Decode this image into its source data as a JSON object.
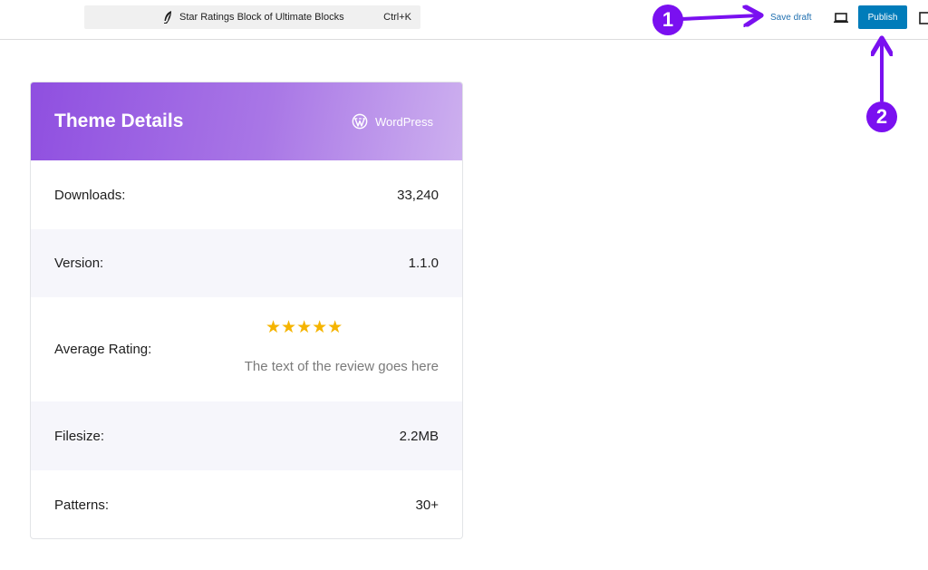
{
  "toolbar": {
    "document_title": "Star Ratings Block of Ultimate Blocks",
    "shortcut": "Ctrl+K",
    "save_draft_label": "Save draft",
    "publish_label": "Publish"
  },
  "annotations": {
    "badge_1": "1",
    "badge_2": "2",
    "color": "#7a10f0"
  },
  "card": {
    "title": "Theme Details",
    "brand": "WordPress",
    "rows": [
      {
        "label": "Downloads:",
        "value": "33,240"
      },
      {
        "label": "Version:",
        "value": "1.1.0"
      },
      {
        "label": "Average Rating:",
        "stars": "★★★★★",
        "rating": 5,
        "review": "The text of the review goes here"
      },
      {
        "label": "Filesize:",
        "value": "2.2MB"
      },
      {
        "label": "Patterns:",
        "value": "30+"
      }
    ]
  },
  "colors": {
    "publish": "#007cba",
    "link": "#2271b1",
    "header_gradient_start": "#8f4fe0",
    "header_gradient_end": "#cdb0ef",
    "star": "#f5b400"
  }
}
